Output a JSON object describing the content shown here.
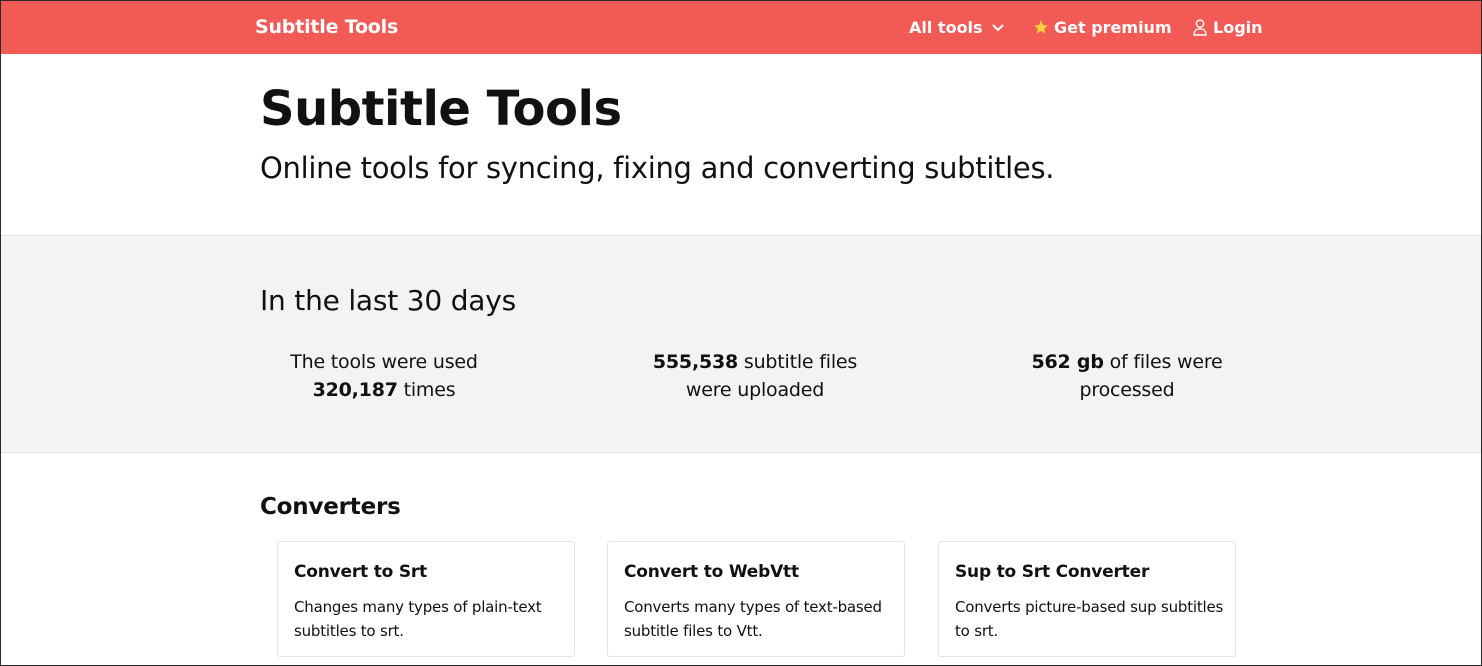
{
  "nav": {
    "brand": "Subtitle Tools",
    "all_tools": "All tools",
    "premium": "Get premium",
    "login": "Login"
  },
  "hero": {
    "title": "Subtitle Tools",
    "subtitle": "Online tools for syncing, fixing and converting subtitles."
  },
  "stats": {
    "heading": "In the last 30 days",
    "items": [
      {
        "prefix": "The tools were used",
        "value": "320,187",
        "suffix": "times"
      },
      {
        "value": "555,538",
        "suffix_line1": "subtitle files",
        "suffix_line2": "were uploaded"
      },
      {
        "value": "562 gb",
        "suffix_line1": "of files were",
        "suffix_line2": "processed"
      }
    ]
  },
  "converters": {
    "heading": "Converters",
    "cards": [
      {
        "title": "Convert to Srt",
        "description": "Changes many types of plain-text subtitles to srt."
      },
      {
        "title": "Convert to WebVtt",
        "description": "Converts many types of text-based subtitle files to Vtt."
      },
      {
        "title": "Sup to Srt Converter",
        "description": "Converts picture-based sup subtitles to srt."
      }
    ]
  },
  "colors": {
    "navbar": "#f25a56",
    "band": "#f2f3f5",
    "star": "#f6cf3a"
  },
  "icons": {
    "chevron": "chevron-down-icon",
    "star": "star-icon",
    "user": "user-icon"
  }
}
